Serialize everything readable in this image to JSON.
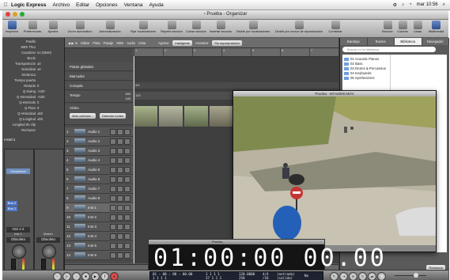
{
  "menubar": {
    "app_name": "Logic Express",
    "menus": [
      "Archivo",
      "Editar",
      "Opciones",
      "Ventana",
      "Ayuda"
    ],
    "clock": "mar 10:56"
  },
  "window": {
    "title": "Prueba - Organizar"
  },
  "toolbar": {
    "left_buttons": [
      "Inspector",
      "Preferencias",
      "Ajustes",
      "Zoom automático",
      "Automatización",
      "Fijar localizadores",
      "Repetir sección",
      "Cortar sección",
      "Insertar sección",
      "Dividir por localizadores",
      "Dividir por cursor de reproducción",
      "Combinar"
    ],
    "right_buttons": [
      "Bounce",
      "Colores",
      "Listas",
      "Multimedia"
    ]
  },
  "inspector": {
    "rows": [
      {
        "label": "Pasillo",
        "value": ""
      },
      {
        "label": "MIDI Thru",
        "value": ""
      },
      {
        "label": "Cuantizar",
        "value": "no (3840)"
      },
      {
        "label": "Bucle",
        "value": ""
      },
      {
        "label": "Transposición",
        "value": "±0"
      },
      {
        "label": "Velocidad",
        "value": "±0"
      },
      {
        "label": "Dinámica",
        "value": ""
      },
      {
        "label": "Tiempo puerta",
        "value": ""
      },
      {
        "label": "Retardo",
        "value": "0"
      },
      {
        "label": "Q-Swing",
        "value": "+100"
      },
      {
        "label": "Q-Intensidad",
        "value": "+100"
      },
      {
        "label": "Q-Intervalo",
        "value": "0"
      },
      {
        "label": "Q-Flam",
        "value": "0"
      },
      {
        "label": "Q-Velocidad",
        "value": "±50"
      },
      {
        "label": "Q-Longitud",
        "value": "±50"
      },
      {
        "label": "Longitud de clip",
        "value": ""
      },
      {
        "label": "Rechazar",
        "value": ""
      }
    ],
    "section": "Inst 1",
    "strip_buttons": [
      "Compresor",
      "Bus 2",
      "Bus 1"
    ],
    "output_label": "Out 1-2",
    "strip_names": [
      "Inst 1",
      "Master"
    ],
    "mode_labels": [
      "Obsoleto",
      "Obsoleto"
    ]
  },
  "arrange": {
    "menus": [
      "Editar",
      "Pista",
      "Pasaje",
      "MIDI",
      "Audio",
      "Vista"
    ],
    "snap_label": "Ajustar:",
    "snap_value": "Inteligente",
    "drag_label": "Arrastrar:",
    "drag_value": "Sin superposición",
    "globals": [
      "Pistas globales",
      "Marcador",
      "Compás",
      "Tempo",
      "Vídeo"
    ],
    "compas_value": "4/4",
    "tempo_value": "120",
    "tempo_max": "160",
    "tempo_min": "140",
    "video_buttons": [
      "Abrir película...",
      "Detectar cortes"
    ],
    "tracks": [
      {
        "num": "1",
        "name": "Audio 1"
      },
      {
        "num": "2",
        "name": "Audio 2"
      },
      {
        "num": "3",
        "name": "Audio 3"
      },
      {
        "num": "4",
        "name": "Audio 4"
      },
      {
        "num": "5",
        "name": "Audio 5"
      },
      {
        "num": "6",
        "name": "Audio 6"
      },
      {
        "num": "7",
        "name": "Audio 7"
      },
      {
        "num": "8",
        "name": "Audio 8"
      },
      {
        "num": "9",
        "name": "Inst 1"
      },
      {
        "num": "10",
        "name": "Inst 2"
      },
      {
        "num": "11",
        "name": "Inst 3"
      },
      {
        "num": "12",
        "name": "Inst 4"
      },
      {
        "num": "13",
        "name": "Inst 5"
      },
      {
        "num": "14",
        "name": "Inst 6"
      }
    ],
    "ruler": [
      "1",
      "2",
      "3",
      "4",
      "5",
      "6",
      "7"
    ],
    "bottom_tabs": [
      "Mezclador",
      "Editor muestras",
      "Editor teclado"
    ]
  },
  "video_window": {
    "title": "Prueba - M7A0000.MOV"
  },
  "timecode_window": {
    "title": "Prueba -",
    "digits": "01:00:00 00.00"
  },
  "browser": {
    "tabs": [
      "Bandeja",
      "Bucles",
      "Biblioteca",
      "Navegador"
    ],
    "selected_tab": "Biblioteca",
    "search_placeholder": "Buscar en la biblioteca",
    "items": [
      "01 Acoustic Pianos",
      "02 Bass",
      "03 Drums & Percussion",
      "04 Keyboards",
      "05 Synthesizers"
    ],
    "bottom_button": "Restaurar"
  },
  "transport": {
    "smpte": "01 : 00 : 00 : 00.00",
    "bars_top": "1  1  1  1",
    "bars_bottom": "1  1  1  1",
    "end_top": "1  1  1  1",
    "end_bottom": "37  1  1  1",
    "tempo": "120.0000",
    "sig": "4/4",
    "div": "/16",
    "rate": "250",
    "in_label": "(entrada)",
    "out_label": "(salida)",
    "mode": "No"
  }
}
